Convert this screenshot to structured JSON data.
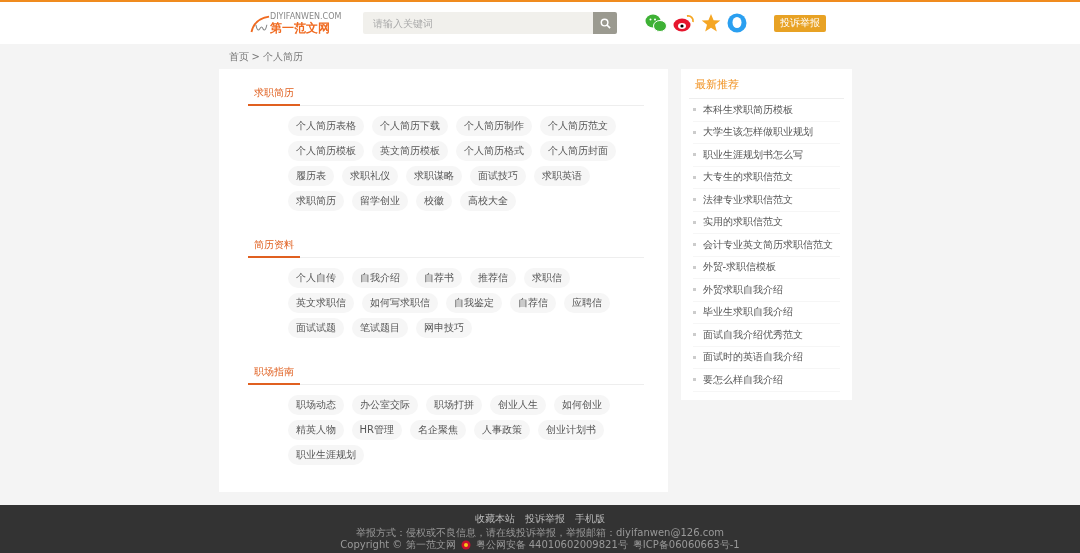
{
  "header": {
    "logo": {
      "domain": "DIYIFANWEN.COM",
      "name": "第一范文网"
    },
    "search": {
      "placeholder": "请输入关键词"
    },
    "report_button": "投诉举报"
  },
  "breadcrumb": {
    "separator": ">",
    "items": [
      "首页",
      "个人简历"
    ]
  },
  "sections": [
    {
      "title": "求职简历",
      "rows": [
        [
          "个人简历表格",
          "个人简历下载",
          "个人简历制作",
          "个人简历范文"
        ],
        [
          "个人简历模板",
          "英文简历模板",
          "个人简历格式",
          "个人简历封面"
        ],
        [
          "履历表",
          "求职礼仪",
          "求职谋略",
          "面试技巧",
          "求职英语"
        ],
        [
          "求职简历",
          "留学创业",
          "校徽",
          "高校大全"
        ]
      ]
    },
    {
      "title": "简历资料",
      "rows": [
        [
          "个人自传",
          "自我介绍",
          "自荐书",
          "推荐信",
          "求职信"
        ],
        [
          "英文求职信",
          "如何写求职信",
          "自我鉴定",
          "自荐信",
          "应聘信"
        ],
        [
          "面试试题",
          "笔试题目",
          "网申技巧"
        ]
      ]
    },
    {
      "title": "职场指南",
      "rows": [
        [
          "职场动态",
          "办公室交际",
          "职场打拼",
          "创业人生",
          "如何创业"
        ],
        [
          "精英人物",
          "HR管理",
          "名企聚焦",
          "人事政策",
          "创业计划书"
        ],
        [
          "职业生涯规划"
        ]
      ]
    }
  ],
  "sidebar": {
    "title": "最新推荐",
    "items": [
      "本科生求职简历模板",
      "大学生该怎样做职业规划",
      "职业生涯规划书怎么写",
      "大专生的求职信范文",
      "法律专业求职信范文",
      "实用的求职信范文",
      "会计专业英文简历求职信范文",
      "外贸-求职信模板",
      "外贸求职自我介绍",
      "毕业生求职自我介绍",
      "面试自我介绍优秀范文",
      "面试时的英语自我介绍",
      "要怎么样自我介绍"
    ]
  },
  "footer": {
    "links": [
      "收藏本站",
      "投诉举报",
      "手机版"
    ],
    "report_line": "举报方式：侵权或不良信息，请在线投诉举报，举报邮箱：diyifanwen@126.com",
    "copyright": "Copyright © 第一范文网",
    "police_record": "粤公网安备 44010602009821号",
    "icp": "粤ICP备06060663号-1"
  }
}
